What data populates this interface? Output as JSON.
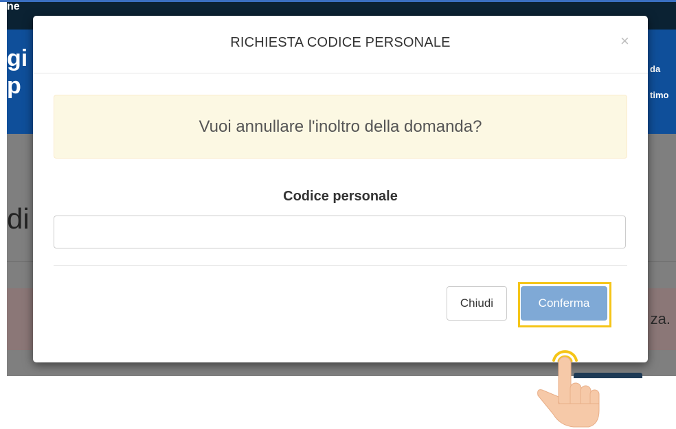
{
  "background": {
    "nav_text": "ne",
    "header_lines": [
      "gi",
      "p"
    ],
    "header_right_lines": [
      "da",
      "timo"
    ],
    "body_text": "di",
    "alert_fragment": "za."
  },
  "modal": {
    "title": "RICHIESTA CODICE PERSONALE",
    "close_symbol": "×",
    "alert_message": "Vuoi annullare l'inoltro della domanda?",
    "field_label": "Codice personale",
    "field_value": "",
    "field_placeholder": "",
    "buttons": {
      "close_label": "Chiudi",
      "confirm_label": "Conferma"
    }
  },
  "colors": {
    "header_blue": "#0f4f9a",
    "alert_bg": "#fcf8e3",
    "confirm_bg": "#7fa9d6",
    "highlight": "#f5c518",
    "hand_skin": "#f6c9a8"
  },
  "icons": {
    "pointer": "hand-pointer-icon",
    "close": "close-icon"
  }
}
